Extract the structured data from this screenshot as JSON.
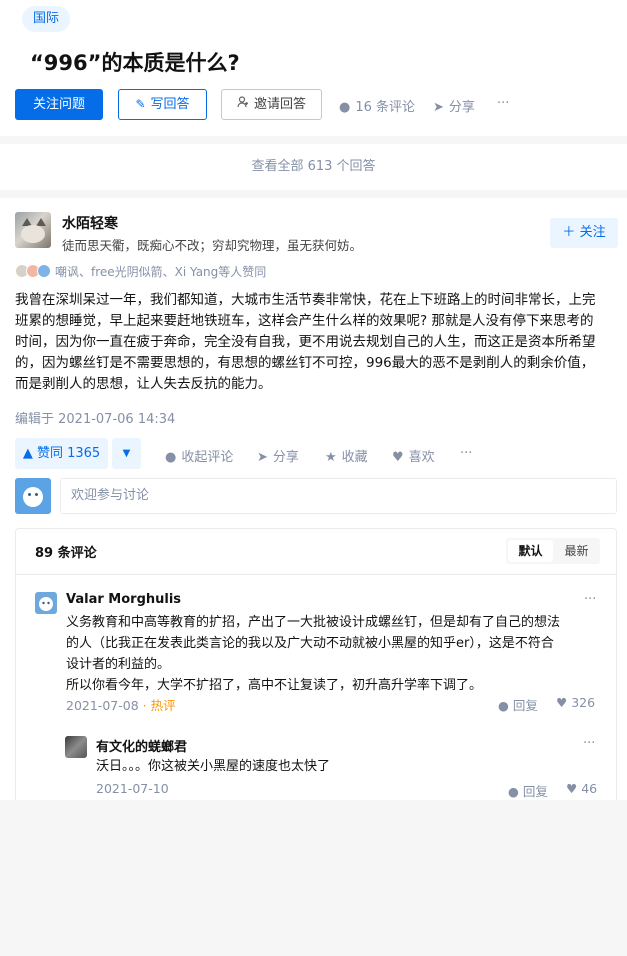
{
  "question": {
    "topic": "国际",
    "title": "“996”的本质是什么?",
    "follow_label": "关注问题",
    "write_answer_label": "写回答",
    "invite_label": "邀请回答",
    "comments_label": "16 条评论",
    "share_label": "分享",
    "more_label": "···"
  },
  "all_answers_label": "查看全部 613 个回答",
  "answer": {
    "author_name": "水陌轻寒",
    "author_bio": "徒而思天衢，既痴心不改；穷却究物理，虽无获何妨。",
    "follow_user_label": "关注",
    "upvoters_text": "嘲讽、free光阴似箭、Xi Yang等人赞同",
    "body_lines": [
      "我曾在深圳呆过一年，我们都知道，大城市生活节奏非常快，花在上下班路上的时间非常长，上完",
      "班累的想睡觉，早上起来要赶地铁班车，这样会产生什么样的效果呢? 那就是人没有停下来思考的",
      "时间，因为你一直在疲于奔命，完全没有自我，更不用说去规划自己的人生，而这正是资本所希望",
      "的，因为螺丝钉是不需要思想的，有思想的螺丝钉不可控，996最大的恶不是剥削人的剩余价值，",
      "而是剥削人的思想，让人失去反抗的能力。"
    ],
    "edited_time": "编辑于 2021-07-06 14:34",
    "vote_up_label": "赞同 1365",
    "vote_down_label": "▼",
    "collapse_comments_label": "收起评论",
    "share_label": "分享",
    "collect_label": "收藏",
    "like_label": "喜欢",
    "more_label": "···",
    "comment_placeholder": "欢迎参与讨论"
  },
  "comments": {
    "count_label": "89 条评论",
    "sort_default": "默认",
    "sort_latest": "最新",
    "items": [
      {
        "name": "Valar Morghulis",
        "body_lines": [
          "义务教育和中高等教育的扩招，产出了一大批被设计成螺丝钉，但是却有了自己的想法",
          "的人（比我正在发表此类言论的我以及广大动不动就被小黑屋的知乎er），这是不符合",
          "设计者的利益的。",
          "所以你看今年，大学不扩招了，高中不让复读了，初升高升学率下调了。"
        ],
        "time": "2021-07-08",
        "hot_label": " · 热评",
        "reply_label": "回复",
        "likes": "326",
        "more_label": "···"
      },
      {
        "name": "有文化的蜣螂君",
        "body_lines": [
          "沃日。。。你这被关小黑屋的速度也太快了"
        ],
        "time": "2021-07-10",
        "reply_label": "回复",
        "likes": "46",
        "more_label": "···"
      }
    ]
  },
  "colors": {
    "brand_blue": "#056de8",
    "light_blue_bg": "#ebf5ff",
    "hot_orange": "#ff9607",
    "meta_gray": "#8590a6"
  },
  "icons": [
    "pen-icon",
    "invite-user-icon",
    "comment-bubble-icon",
    "share-icon",
    "plus-icon",
    "triangle-up-icon",
    "star-icon",
    "heart-icon"
  ]
}
